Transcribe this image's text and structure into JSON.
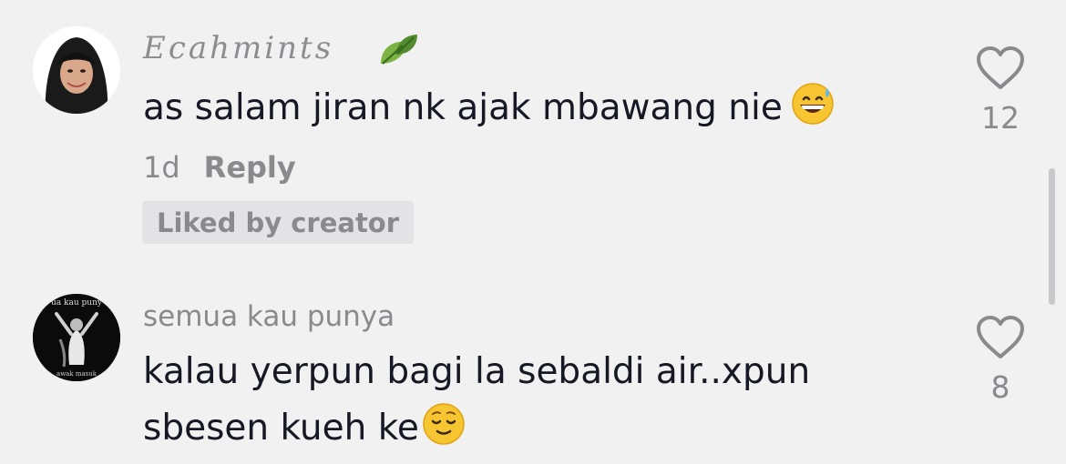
{
  "comments": [
    {
      "username": "Ecahmints",
      "username_icon": "leaf-icon",
      "text": "as salam jiran nk ajak mbawang nie",
      "emoji": "grinning-sweat-emoji",
      "time": "1d",
      "reply_label": "Reply",
      "badge": "Liked by creator",
      "like_count": "12",
      "avatar": "woman-hijab-avatar"
    },
    {
      "username": "semua kau punya",
      "text_line1": "kalau yerpun bagi la sebaldi air..xpun",
      "text_line2": "sbesen kueh ke",
      "emoji": "relieved-face-emoji",
      "like_count": "8",
      "avatar": "dark-photo-avatar",
      "avatar_caption_top": "ua kau puny",
      "avatar_caption_bottom": "awak masuk"
    }
  ],
  "colors": {
    "background": "#f1f1f2",
    "text": "#161823",
    "muted": "#8a8a8d",
    "badge_bg": "#e3e3e5"
  }
}
